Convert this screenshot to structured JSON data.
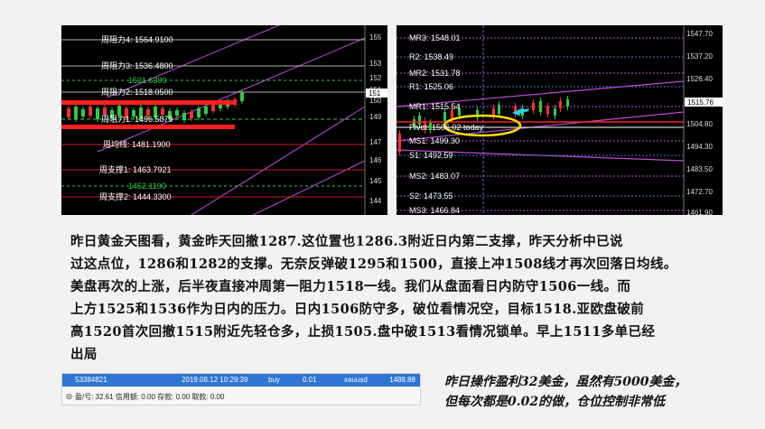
{
  "charts": {
    "left": {
      "levels": [
        {
          "label": "周阻力4: 1564.9100"
        },
        {
          "label": "周阻力3: 1536.4800"
        },
        {
          "label": "1531.6300"
        },
        {
          "label": "周阻力2: 1518.0500"
        },
        {
          "label": "周阻力1: 1496.5879"
        },
        {
          "label": "周均线: 1481.1900"
        },
        {
          "label": "周支撑1: 1463.7921"
        },
        {
          "label": "1452.1100"
        },
        {
          "label": "周支撑2: 1444.3300"
        }
      ],
      "axis": [
        "155",
        "153",
        "152",
        "151",
        "150",
        "149",
        "147",
        "146",
        "145",
        "144"
      ],
      "price_tag": "151"
    },
    "right": {
      "levels": [
        {
          "label": "MR3: 1548.01"
        },
        {
          "label": "R2: 1538.49"
        },
        {
          "label": "MR2: 1531.78"
        },
        {
          "label": "R1: 1525.06"
        },
        {
          "label": "MR1: 1515.54"
        },
        {
          "label": "Pivot: 1506.02   today"
        },
        {
          "label": "MS1: 1499.30"
        },
        {
          "label": "S1: 1492.59"
        },
        {
          "label": "MS2: 1483.07"
        },
        {
          "label": "S2: 1473.55"
        },
        {
          "label": "MS3: 1466.84"
        }
      ],
      "axis": [
        "1547.70",
        "1537.20",
        "1526.40",
        "1515.76",
        "1504.80",
        "1494.30",
        "1483.50",
        "1472.70",
        "1461.90"
      ],
      "price_tag": "1515.76"
    }
  },
  "text": {
    "main_lines": [
      "昨日黄金天图看，黄金昨天回撤1287.这位置也1286.3附近日内第二支撑，昨天分析中已说",
      "过这点位，1286和1282的支撑。无奈反弹破1295和1500，直接上冲1508线才再次回落日均线。",
      "美盘再次的上涨，后半夜直接冲周第一阻力1518一线。我们从盘面看日内防守1506一线。而",
      "上方1525和1536作为日内的压力。日内1506防守多，破位看情况空，目标1518.亚欧盘破前",
      "高1520首次回撤1515附近先轻仓多，止损1505.盘中破1513看情况锁单。早上1511多单已经",
      "出局"
    ],
    "side_lines": [
      "昨日操作盈利32美金，虽然有5000美金，",
      "但每次都是0.02的做，仓位控制非常低"
    ]
  },
  "trade": {
    "order_id": "53384821",
    "time": "2019.08.12 10:29:39",
    "type": "buy",
    "volume": "0.01",
    "symbol": "xauusd",
    "price": "1488.88",
    "summary": "盈/亏: 32.61  信用额: 0.00  存款: 0.00  取款: 0.00"
  }
}
